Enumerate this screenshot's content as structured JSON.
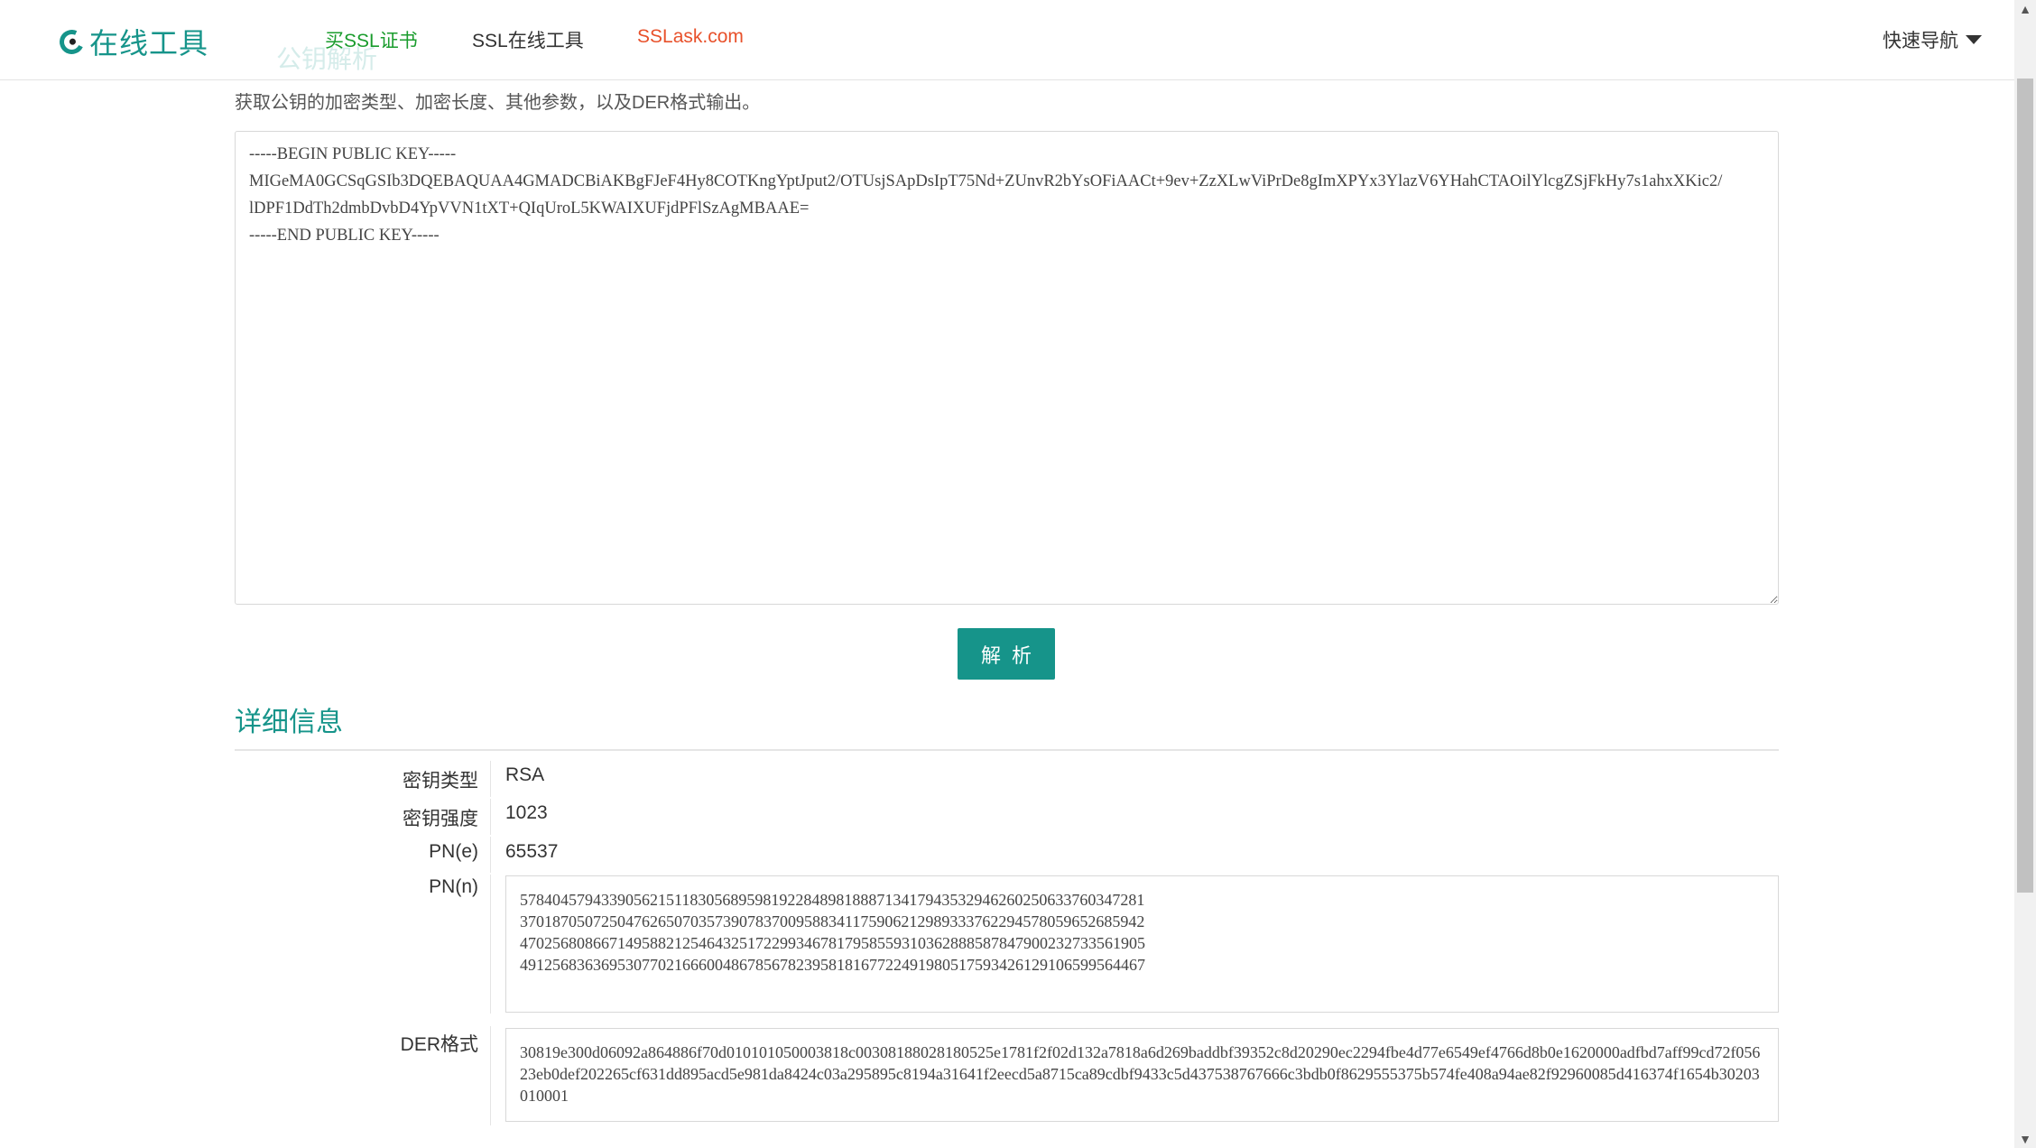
{
  "header": {
    "logo_text": "在线工具",
    "nav": [
      {
        "label": "买SSL证书"
      },
      {
        "label": "SSL在线工具"
      },
      {
        "label": "SSLask.com"
      }
    ],
    "ghost_title": "公钥解析",
    "quick_nav_label": "快速导航"
  },
  "main": {
    "intro": "获取公钥的加密类型、加密长度、其他参数，以及DER格式输出。",
    "key_text": "-----BEGIN PUBLIC KEY-----\nMIGeMA0GCSqGSIb3DQEBAQUAA4GMADCBiAKBgFJeF4Hy8COTKngYptJput2/OTUsjSApDsIpT75Nd+ZUnvR2bYsOFiAACt+9ev+ZzXLwViPrDe8gImXPYx3YlazV6YHahCTAOilYlcgZSjFkHy7s1ahxXKic2/\nlDPF1DdTh2dmbDvbD4YpVVN1tXT+QIqUroL5KWAIXUFjdPFlSzAgMBAAE=\n-----END PUBLIC KEY-----",
    "parse_button": "解析"
  },
  "details": {
    "title": "详细信息",
    "key_type": {
      "label": "密钥类型",
      "value": "RSA"
    },
    "key_strength": {
      "label": "密钥强度",
      "value": "1023"
    },
    "pn_e": {
      "label": "PN(e)",
      "value": "65537"
    },
    "pn_n": {
      "label": "PN(n)",
      "value": "57840457943390562151183056895981922848981888713417943532946260250633760347281370187050725047626507035739078370095883411759062129893337622945780596526859424702568086671495882125464325172299346781795855931036288858784790023273356190549125683636953077021666004867856782395818167722491980517593426129106599564467"
    },
    "der": {
      "label": "DER格式",
      "value": "30819e300d06092a864886f70d010101050003818c00308188028180525e1781f2f02d132a7818a6d269baddbf39352c8d20290ec2294fbe4d77e6549ef4766d8b0e1620000adfbd7aff99cd72f05623eb0def202265cf631dd895acd5e981da8424c03a295895c8194a31641f2eecd5a8715ca89cdbf9433c5d437538767666c3bdb0f8629555375b574fe408a94ae82f92960085d416374f1654b30203010001"
    }
  },
  "scrollbar": {
    "up_icon": "▲",
    "down_icon": "▼"
  },
  "colors": {
    "accent": "#16948a",
    "buy_link": "#1a9c2d",
    "sslask_link": "#e8512b"
  }
}
